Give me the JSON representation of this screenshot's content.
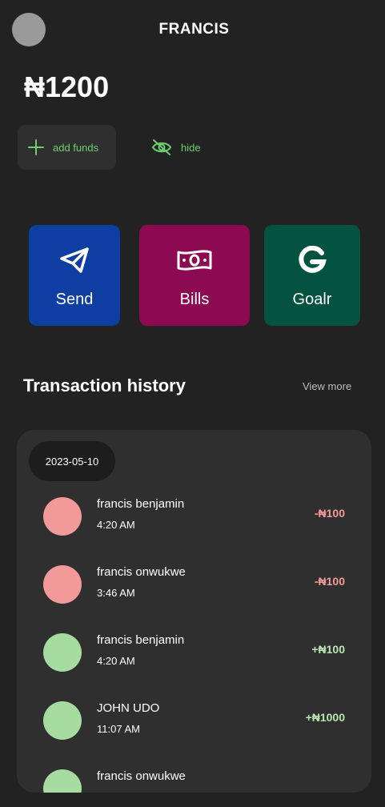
{
  "header": {
    "title": "FRANCIS"
  },
  "balance": {
    "amount": "₦1200"
  },
  "wallet_actions": {
    "add_funds_label": "add funds",
    "hide_label": "hide"
  },
  "quick_actions": [
    {
      "label": "Send",
      "icon": "send-icon",
      "color": "#0f3ea3"
    },
    {
      "label": "Bills",
      "icon": "banknote-icon",
      "color": "#8b0a52"
    },
    {
      "label": "Goalr",
      "icon": "goalr-logo-icon",
      "color": "#045240"
    }
  ],
  "transactions": {
    "title": "Transaction history",
    "view_more": "View more",
    "date": "2023-05-10",
    "items": [
      {
        "name": "francis benjamin",
        "time": "4:20 AM",
        "amount": "-₦100",
        "type": "debit"
      },
      {
        "name": "francis onwukwe",
        "time": "3:46 AM",
        "amount": "-₦100",
        "type": "debit"
      },
      {
        "name": "francis benjamin",
        "time": "4:20 AM",
        "amount": "+₦100",
        "type": "credit"
      },
      {
        "name": "JOHN UDO",
        "time": "11:07 AM",
        "amount": "+₦1000",
        "type": "credit"
      },
      {
        "name": "francis onwukwe",
        "time": "",
        "amount": "",
        "type": "credit"
      }
    ]
  },
  "colors": {
    "debit": "#f29a9a",
    "credit": "#a7dca0",
    "accent_green": "#6fcf6f"
  }
}
